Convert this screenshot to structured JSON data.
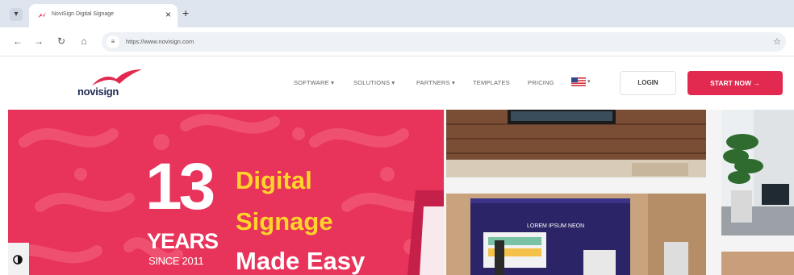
{
  "browser": {
    "tab_title": "NoviSign Digital Signage",
    "tab_close": "×",
    "new_tab": "+",
    "url": "https://www.novisign.com"
  },
  "site": {
    "logo_text": "novisign",
    "menu": [
      {
        "label": "SOFTWARE ▾"
      },
      {
        "label": "SOLUTIONS ▾"
      },
      {
        "label": "PARTNERS ▾"
      },
      {
        "label": "TEMPLATES"
      },
      {
        "label": "PRICING"
      }
    ],
    "language_caret": "▾",
    "login_label": "LOGIN",
    "start_label": "START NOW →"
  },
  "hero": {
    "number": "13",
    "years": "YEARS",
    "since": "SINCE 2011",
    "line1": "Digital",
    "line2": "Signage",
    "line3": "Made Easy",
    "screen_text": "LOREM IPSUM NEON"
  },
  "colors": {
    "brand_red": "#e2294f",
    "hero_red": "#e8335a",
    "tagline_yellow": "#ffd42b",
    "navy": "#1d2a52"
  }
}
